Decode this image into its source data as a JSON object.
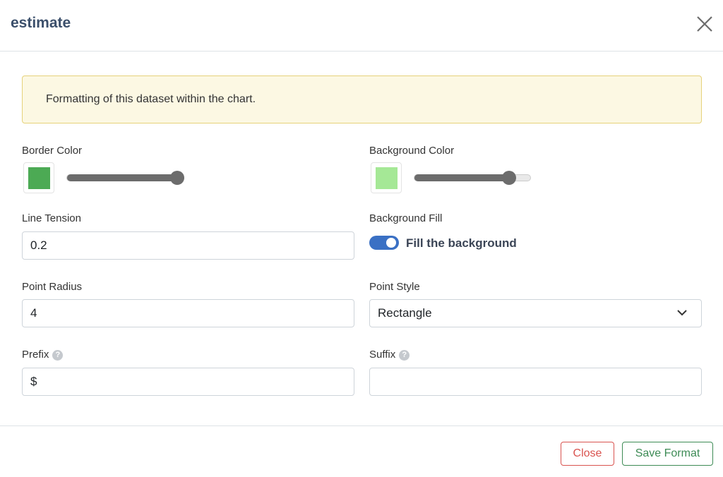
{
  "modal": {
    "title": "estimate",
    "close_icon": "close-x-icon"
  },
  "alert": {
    "text": "Formatting of this dataset within the chart."
  },
  "border_color": {
    "label": "Border Color",
    "color": "#4caa54",
    "opacity_percent": 100
  },
  "background_color": {
    "label": "Background Color",
    "color": "#a5e896",
    "opacity_percent": 85
  },
  "line_tension": {
    "label": "Line Tension",
    "value": "0.2"
  },
  "background_fill": {
    "label": "Background Fill",
    "toggle_label": "Fill the background",
    "checked": true
  },
  "point_radius": {
    "label": "Point Radius",
    "value": "4"
  },
  "point_style": {
    "label": "Point Style",
    "value": "Rectangle"
  },
  "prefix": {
    "label": "Prefix",
    "value": "$",
    "help": "?"
  },
  "suffix": {
    "label": "Suffix",
    "value": "",
    "help": "?"
  },
  "footer": {
    "close_label": "Close",
    "save_label": "Save Format"
  },
  "colors": {
    "danger": "#d9534f",
    "success": "#3d8b55",
    "toggle": "#3a70c4"
  }
}
